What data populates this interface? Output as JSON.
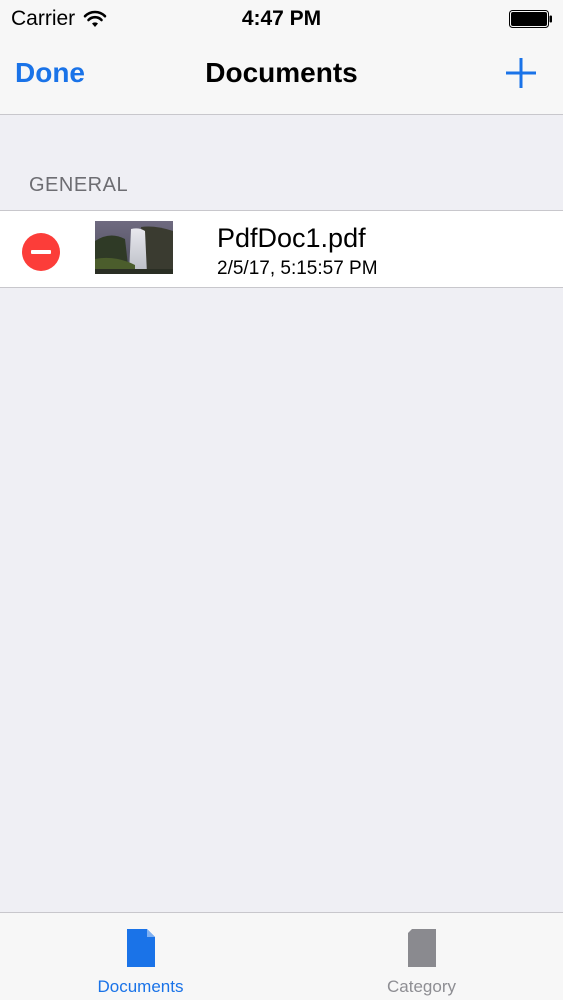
{
  "status_bar": {
    "carrier": "Carrier",
    "time": "4:47 PM",
    "wifi_icon": "wifi-icon",
    "battery_icon": "battery-icon"
  },
  "nav_bar": {
    "left_button": "Done",
    "title": "Documents",
    "right_icon": "plus-icon"
  },
  "section": {
    "header": "GENERAL",
    "items": [
      {
        "name": "PdfDoc1.pdf",
        "date": "2/5/17, 5:15:57 PM",
        "thumbnail": "waterfall-thumbnail",
        "delete_icon": "delete-minus-icon"
      }
    ]
  },
  "tab_bar": {
    "tabs": [
      {
        "label": "Documents",
        "icon": "document-icon",
        "selected": true
      },
      {
        "label": "Category",
        "icon": "category-icon",
        "selected": false
      }
    ]
  },
  "colors": {
    "accent": "#1a73e8",
    "delete": "#fc3d39",
    "background": "#efeff4",
    "bar": "#f7f7f7",
    "inactive": "#8e8e93"
  }
}
